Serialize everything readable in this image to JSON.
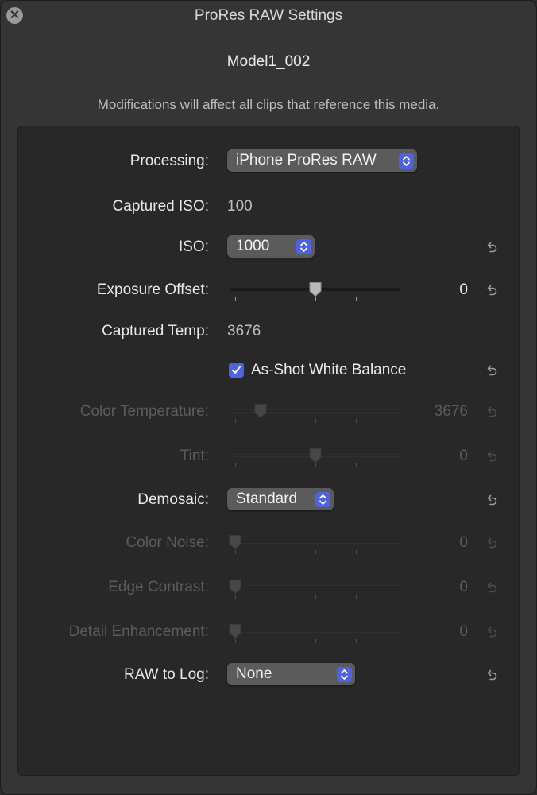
{
  "window": {
    "title": "ProRes RAW Settings"
  },
  "media_name": "Model1_002",
  "notice": "Modifications will affect all clips that reference this media.",
  "colors": {
    "accent": "#4f62e3",
    "panel": "#282828",
    "window": "#353535"
  },
  "fields": {
    "processing": {
      "label": "Processing:",
      "value": "iPhone ProRes RAW",
      "icon": "chevron-updown-icon"
    },
    "captured_iso": {
      "label": "Captured ISO:",
      "value": "100"
    },
    "iso": {
      "label": "ISO:",
      "value": "1000"
    },
    "exposure_offset": {
      "label": "Exposure Offset:",
      "value": "0",
      "level": 0.5
    },
    "captured_temp": {
      "label": "Captured Temp:",
      "value": "3676"
    },
    "as_shot_wb": {
      "label": "As-Shot White Balance",
      "checked": true
    },
    "color_temperature": {
      "label": "Color Temperature:",
      "value": "3676",
      "level": 0.16,
      "enabled": false
    },
    "tint": {
      "label": "Tint:",
      "value": "0",
      "level": 0.5,
      "enabled": false
    },
    "demosaic": {
      "label": "Demosaic:",
      "value": "Standard"
    },
    "color_noise": {
      "label": "Color Noise:",
      "value": "0",
      "level": 0.0,
      "enabled": false
    },
    "edge_contrast": {
      "label": "Edge Contrast:",
      "value": "0",
      "level": 0.0,
      "enabled": false
    },
    "detail_enhancement": {
      "label": "Detail Enhancement:",
      "value": "0",
      "level": 0.0,
      "enabled": false
    },
    "raw_to_log": {
      "label": "RAW to Log:",
      "value": "None"
    }
  }
}
